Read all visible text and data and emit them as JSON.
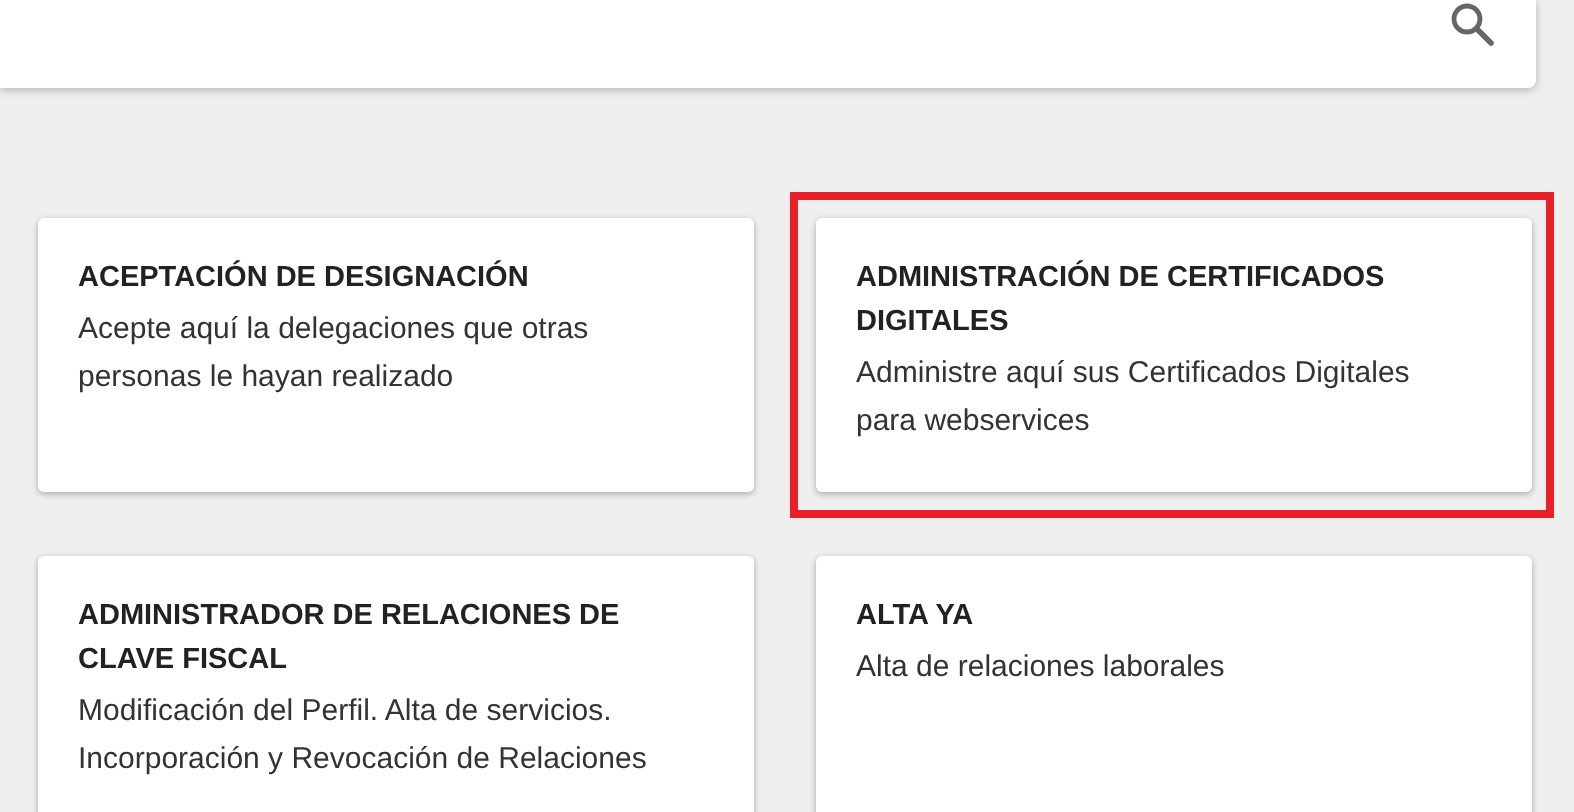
{
  "cards": [
    {
      "title": "ACEPTACIÓN DE DESIGNACIÓN",
      "description": "Acepte aquí la delegaciones que otras personas le hayan realizado",
      "highlighted": false
    },
    {
      "title": "ADMINISTRACIÓN DE CERTIFICADOS DIGITALES",
      "description": "Administre aquí sus Certificados Digitales para webservices",
      "highlighted": true
    },
    {
      "title": "ADMINISTRADOR DE RELACIONES DE CLAVE FISCAL",
      "description": "Modificación del Perfil. Alta de servicios. Incorporación y Revocación de Relaciones",
      "highlighted": false
    },
    {
      "title": "ALTA YA",
      "description": "Alta de relaciones laborales",
      "highlighted": false
    }
  ]
}
